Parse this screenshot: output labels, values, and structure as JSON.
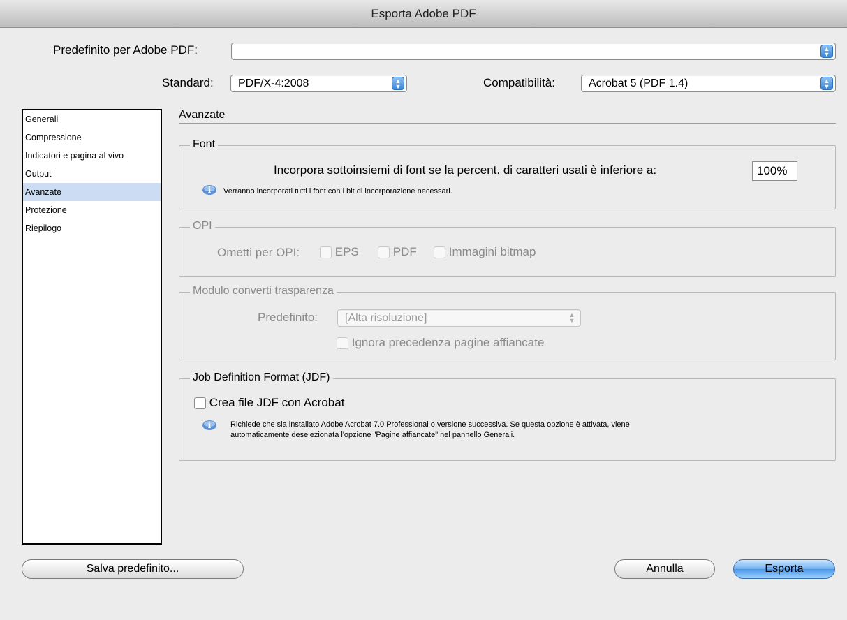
{
  "window": {
    "title": "Esporta Adobe PDF"
  },
  "top": {
    "preset_label": "Predefinito per Adobe PDF:",
    "preset_value": "",
    "standard_label": "Standard:",
    "standard_value": "PDF/X-4:2008",
    "compat_label": "Compatibilità:",
    "compat_value": "Acrobat 5 (PDF 1.4)"
  },
  "sidebar": {
    "items": [
      {
        "label": "Generali",
        "selected": false
      },
      {
        "label": "Compressione",
        "selected": false
      },
      {
        "label": "Indicatori e pagina al vivo",
        "selected": false
      },
      {
        "label": "Output",
        "selected": false
      },
      {
        "label": "Avanzate",
        "selected": true
      },
      {
        "label": "Protezione",
        "selected": false
      },
      {
        "label": "Riepilogo",
        "selected": false
      }
    ]
  },
  "panel": {
    "title": "Avanzate",
    "font": {
      "legend": "Font",
      "subset_label": "Incorpora sottoinsiemi di font se la percent. di caratteri usati è inferiore a:",
      "subset_value": "100%",
      "info": "Verranno incorporati tutti i font con i bit di incorporazione necessari."
    },
    "opi": {
      "legend": "OPI",
      "omit_label": "Ometti per OPI:",
      "options": [
        "EPS",
        "PDF",
        "Immagini bitmap"
      ]
    },
    "flattener": {
      "legend": "Modulo converti trasparenza",
      "preset_label": "Predefinito:",
      "preset_value": "[Alta risoluzione]",
      "ignore_label": "Ignora precedenza pagine affiancate"
    },
    "jdf": {
      "legend": "Job Definition Format (JDF)",
      "create_label": "Crea file JDF con Acrobat",
      "info_line1": "Richiede che sia installato Adobe Acrobat 7.0 Professional o versione successiva. Se questa opzione è attivata, viene",
      "info_line2": "automaticamente deselezionata l'opzione \"Pagine affiancate\" nel pannello Generali."
    }
  },
  "buttons": {
    "save_preset": "Salva predefinito...",
    "cancel": "Annulla",
    "export": "Esporta"
  },
  "icons": {
    "stepper": "up-down-arrows-icon",
    "info": "info-icon"
  }
}
